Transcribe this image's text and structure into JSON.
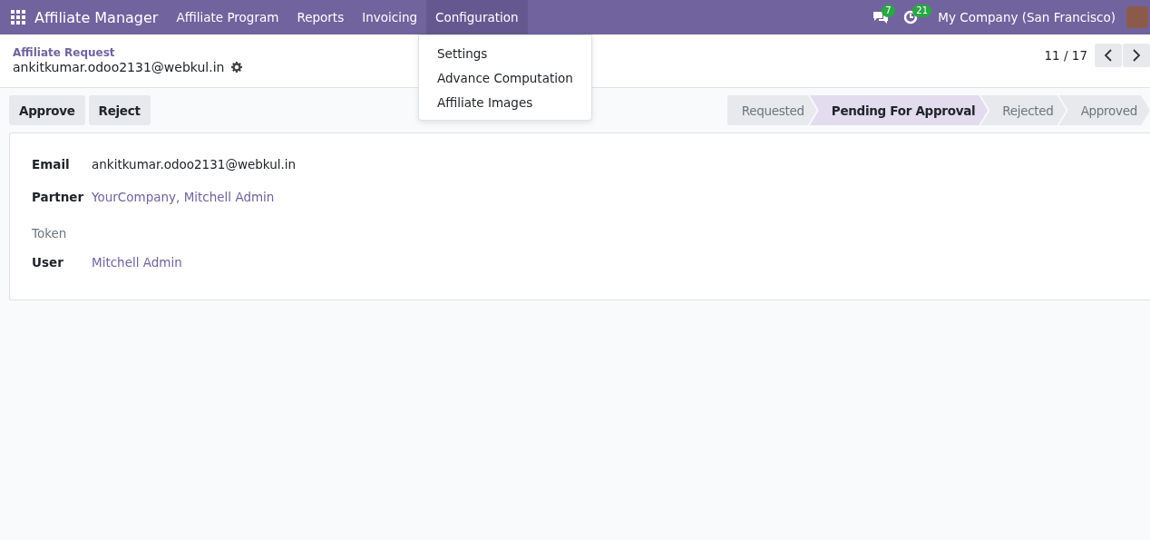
{
  "navbar": {
    "app_title": "Affiliate Manager",
    "menus": [
      {
        "label": "Affiliate Program",
        "selected": false
      },
      {
        "label": "Reports",
        "selected": false
      },
      {
        "label": "Invoicing",
        "selected": false
      },
      {
        "label": "Configuration",
        "selected": true
      }
    ],
    "messages_count": "7",
    "activities_count": "21",
    "company": "My Company (San Francisco)"
  },
  "dropdown": {
    "items": [
      "Settings",
      "Advance Computation",
      "Affiliate Images"
    ]
  },
  "breadcrumb": {
    "parent": "Affiliate Request",
    "current": "ankitkumar.odoo2131@webkul.in"
  },
  "pager": {
    "value": "11 / 17"
  },
  "buttons": [
    "Approve",
    "Reject"
  ],
  "stages": [
    {
      "label": "Requested",
      "selected": false
    },
    {
      "label": "Pending For Approval",
      "selected": true
    },
    {
      "label": "Rejected",
      "selected": false
    },
    {
      "label": "Approved",
      "selected": false
    }
  ],
  "fields": [
    {
      "label": "Email",
      "kind": "text",
      "value": "ankitkumar.odoo2131@webkul.in"
    },
    {
      "label": "Partner",
      "kind": "link",
      "value": "YourCompany, Mitchell Admin"
    },
    {
      "label": "Token",
      "kind": "empty"
    },
    {
      "label": "User",
      "kind": "link",
      "value": "Mitchell Admin"
    }
  ]
}
